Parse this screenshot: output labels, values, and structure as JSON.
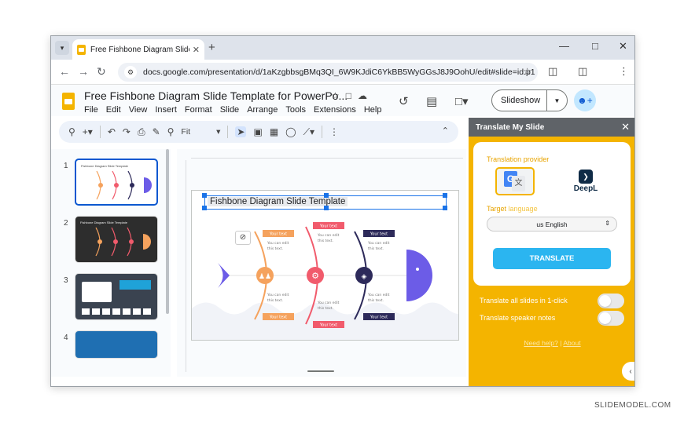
{
  "browser": {
    "tab_title": "Free Fishbone Diagram Slide Te",
    "url": "docs.google.com/presentation/d/1aKzgbbsgBMq3QI_6W9KJdiC6YkBB5WyGGsJ8J9OohU/edit#slide=id.p1"
  },
  "doc": {
    "title": "Free Fishbone Diagram Slide Template for PowerPo...",
    "menu": [
      "File",
      "Edit",
      "View",
      "Insert",
      "Format",
      "Slide",
      "Arrange",
      "Tools",
      "Extensions",
      "Help"
    ],
    "slideshow_label": "Slideshow"
  },
  "toolbar": {
    "zoom_label": "Fit"
  },
  "filmstrip": {
    "slides": [
      {
        "num": "1",
        "bg": "#ffffff"
      },
      {
        "num": "2",
        "bg": "#2d2d2d"
      },
      {
        "num": "3",
        "bg": "#3a4350"
      },
      {
        "num": "4",
        "bg": "#1f6fb2"
      }
    ],
    "thumb_title": "Fishbone Diagram Slide Template"
  },
  "slide": {
    "title": "Fishbone Diagram Slide Template",
    "label": "Your text",
    "body": "You can edit this text.",
    "colors": {
      "orange": "#f5a25d",
      "red": "#f15b6c",
      "navy": "#2d2a5a",
      "purple": "#6c5ce7"
    }
  },
  "panel": {
    "title": "Translate My Slide",
    "provider_label": "Translation provider",
    "google_glyph": "G",
    "translate_glyph": "文",
    "deepl_name": "DeepL",
    "language_label_a": "Target",
    "language_label_b": "language",
    "language_value": "us English",
    "translate_button": "TRANSLATE",
    "option_all_slides": "Translate all slides in 1-click",
    "option_speaker_notes": "Translate speaker notes",
    "help_link": "Need help?",
    "link_sep": "|",
    "about_link": "About"
  },
  "watermark": "SLIDEMODEL.COM"
}
